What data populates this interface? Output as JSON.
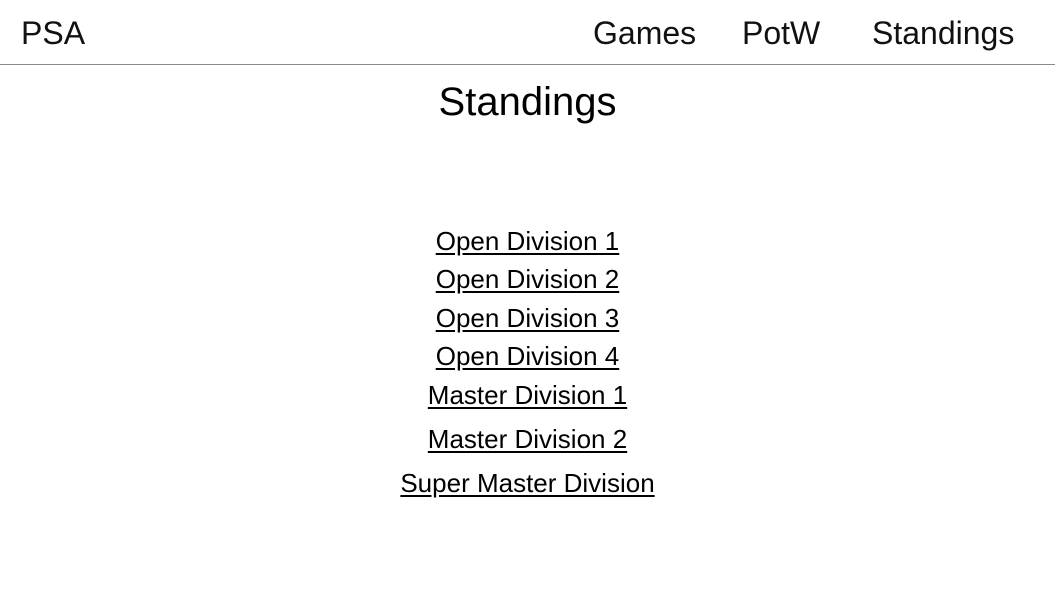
{
  "header": {
    "brand": "PSA",
    "nav": {
      "games": "Games",
      "potw": "PotW",
      "standings": "Standings"
    }
  },
  "main": {
    "title": "Standings",
    "divisions": [
      "Open Division 1",
      "Open Division 2",
      "Open Division 3",
      "Open Division 4",
      "Master Division 1",
      "Master Division 2",
      "Super Master Division"
    ]
  }
}
